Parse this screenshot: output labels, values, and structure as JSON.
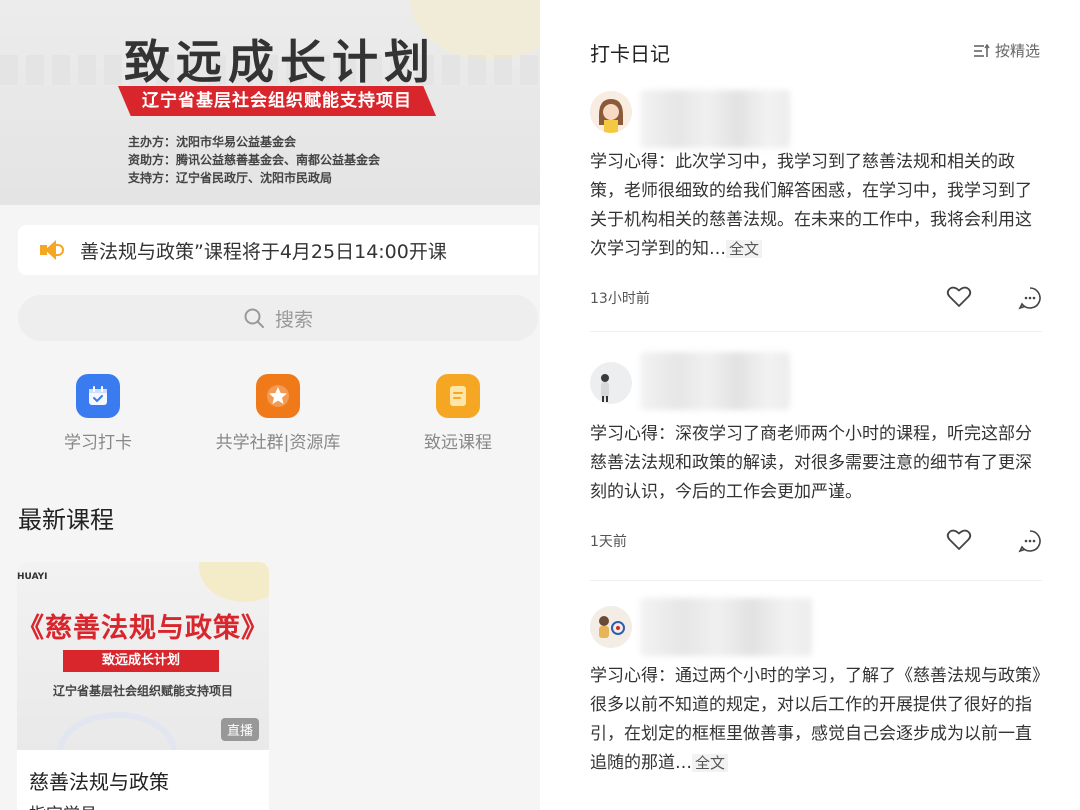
{
  "left": {
    "banner": {
      "title": "致远成长计划",
      "ribbon": "辽宁省基层社会组织赋能支持项目",
      "sponsors": [
        {
          "key": "主办方：",
          "value": "沈阳市华易公益基金会"
        },
        {
          "key": "资助方：",
          "value": "腾讯公益慈善基金会、南都公益基金会"
        },
        {
          "key": "支持方：",
          "value": "辽宁省民政厅、沈阳市民政局"
        }
      ]
    },
    "notice": {
      "icon": "speaker-icon",
      "text": "善法规与政策”课程将于4月25日14:00开课"
    },
    "search": {
      "icon": "search-icon",
      "placeholder": "搜索"
    },
    "quick_links": [
      {
        "label": "学习打卡",
        "icon": "calendar-check-icon",
        "color": "#3a7cf0"
      },
      {
        "label": "共学社群|资源库",
        "icon": "star-icon",
        "color": "#f07a1a"
      },
      {
        "label": "致远课程",
        "icon": "document-icon",
        "color": "#f5a623"
      }
    ],
    "section_title": "最新课程",
    "course": {
      "thumb_brand": "HUAYI",
      "thumb_title": "《慈善法规与政策》",
      "thumb_ribbon": "致远成长计划",
      "thumb_sub": "辽宁省基层社会组织赋能支持项目",
      "live_badge": "直播",
      "name": "慈善法规与政策",
      "meta": "指定学员"
    }
  },
  "right": {
    "title": "打卡日记",
    "filter_label": "按精选",
    "filter_icon": "filter-icon",
    "posts": [
      {
        "text": "学习心得：此次学习中，我学习到了慈善法规和相关的政策，老师很细致的给我们解答困惑，在学习中，我学习到了关于机构相关的慈善法规。在未来的工作中，我将会利用这次学习学到的知…",
        "more": "全文",
        "time": "13小时前"
      },
      {
        "text": "学习心得：深夜学习了商老师两个小时的课程，听完这部分慈善法法规和政策的解读，对很多需要注意的细节有了更深刻的认识，今后的工作会更加严谨。",
        "more": "",
        "time": "1天前"
      },
      {
        "text": "学习心得：通过两个小时的学习，了解了《慈善法规与政策》很多以前不知道的规定，对以后工作的开展提供了很好的指引，在划定的框框里做善事，感觉自己会逐步成为以前一直追随的那道…",
        "more": "全文",
        "time": ""
      }
    ]
  }
}
